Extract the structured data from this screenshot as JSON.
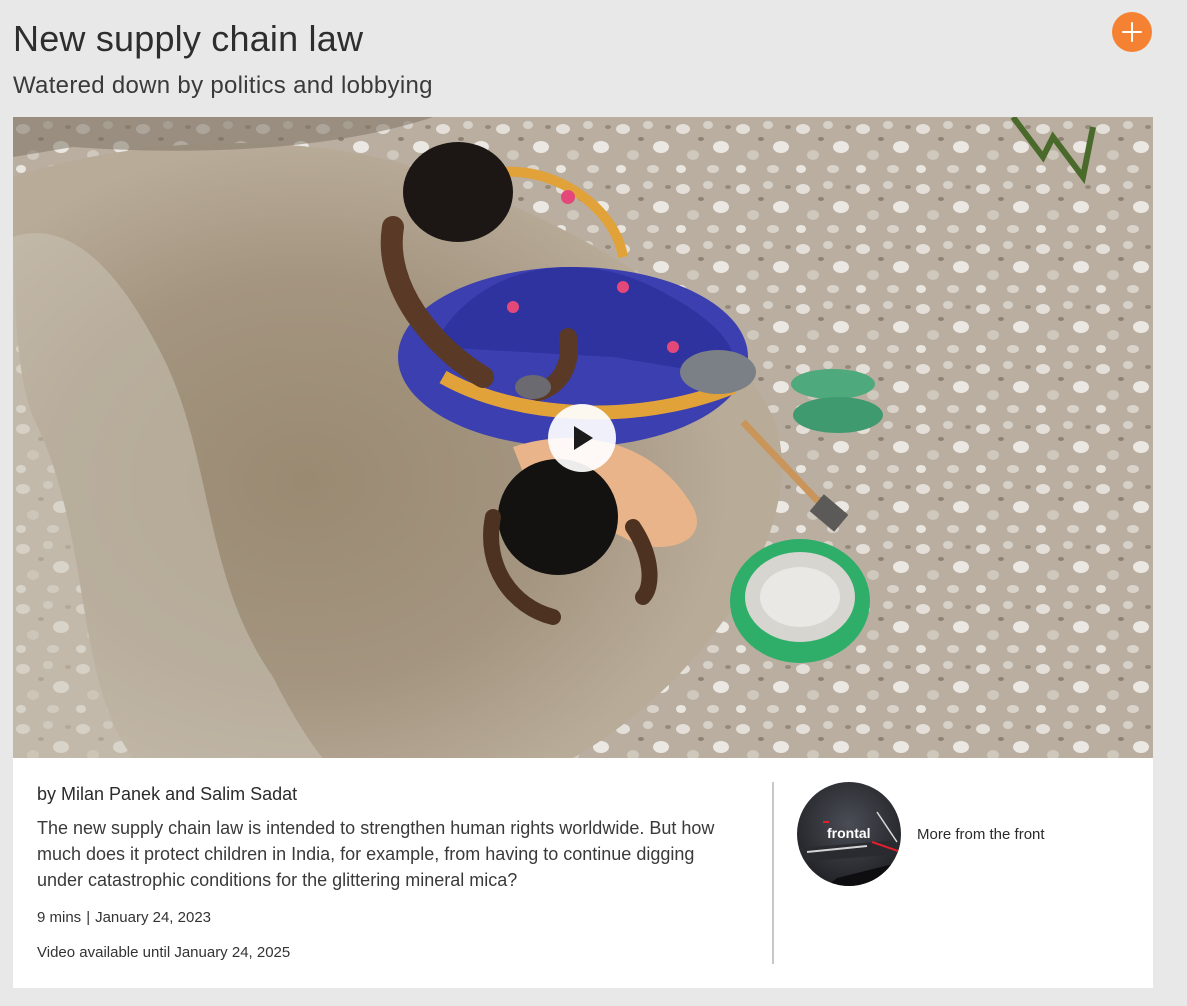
{
  "article": {
    "title": "New supply chain law",
    "subtitle": "Watered down by politics and lobbying",
    "byline": "by Milan Panek and Salim Sadat",
    "description": "The new supply chain law is intended to strengthen human rights worldwide. But how much does it protect children in India, for example, from having to continue digging under catastrophic conditions for the glittering mineral mica?",
    "duration": "9 mins",
    "separator": "|",
    "date": "January 24, 2023",
    "availability": "Video available until January 24, 2025"
  },
  "show": {
    "logo_text": "frontal",
    "link_label": "More from the front"
  },
  "icons": {
    "add": "plus-icon",
    "play": "play-icon"
  },
  "colors": {
    "accent": "#f58232",
    "background": "#e8e8e8",
    "card": "#ffffff"
  }
}
